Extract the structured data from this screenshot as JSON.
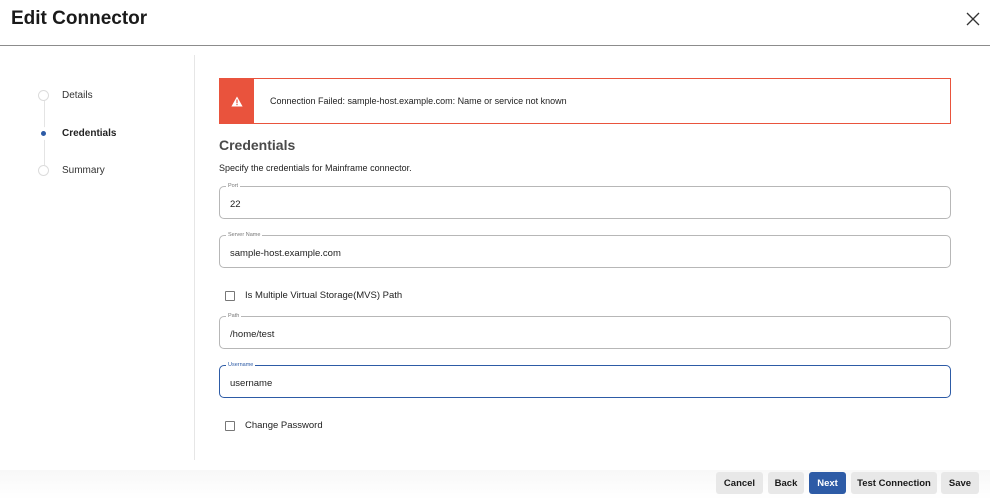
{
  "dialog": {
    "title": "Edit Connector",
    "close_icon": "close-icon"
  },
  "stepper": {
    "steps": [
      {
        "label": "Details",
        "state": "pending"
      },
      {
        "label": "Credentials",
        "state": "active"
      },
      {
        "label": "Summary",
        "state": "pending"
      }
    ],
    "active_color": "#2d5ba6"
  },
  "alert": {
    "icon": "warning-icon",
    "color": "#e9533d",
    "message": "Connection Failed: sample-host.example.com: Name or service not known"
  },
  "section": {
    "title": "Credentials",
    "description": "Specify the credentials for Mainframe connector."
  },
  "form": {
    "port": {
      "label": "Port",
      "value": "22"
    },
    "server_name": {
      "label": "Server Name",
      "value": "sample-host.example.com"
    },
    "mvs_checkbox": {
      "label": "Is Multiple Virtual Storage(MVS) Path",
      "checked": false
    },
    "path": {
      "label": "Path",
      "value": "/home/test"
    },
    "username": {
      "label": "Username",
      "value": "username",
      "focused": true
    },
    "change_password": {
      "label": "Change Password",
      "checked": false
    }
  },
  "footer": {
    "cancel_label": "Cancel",
    "back_label": "Back",
    "next_label": "Next",
    "test_label": "Test Connection",
    "save_label": "Save"
  }
}
